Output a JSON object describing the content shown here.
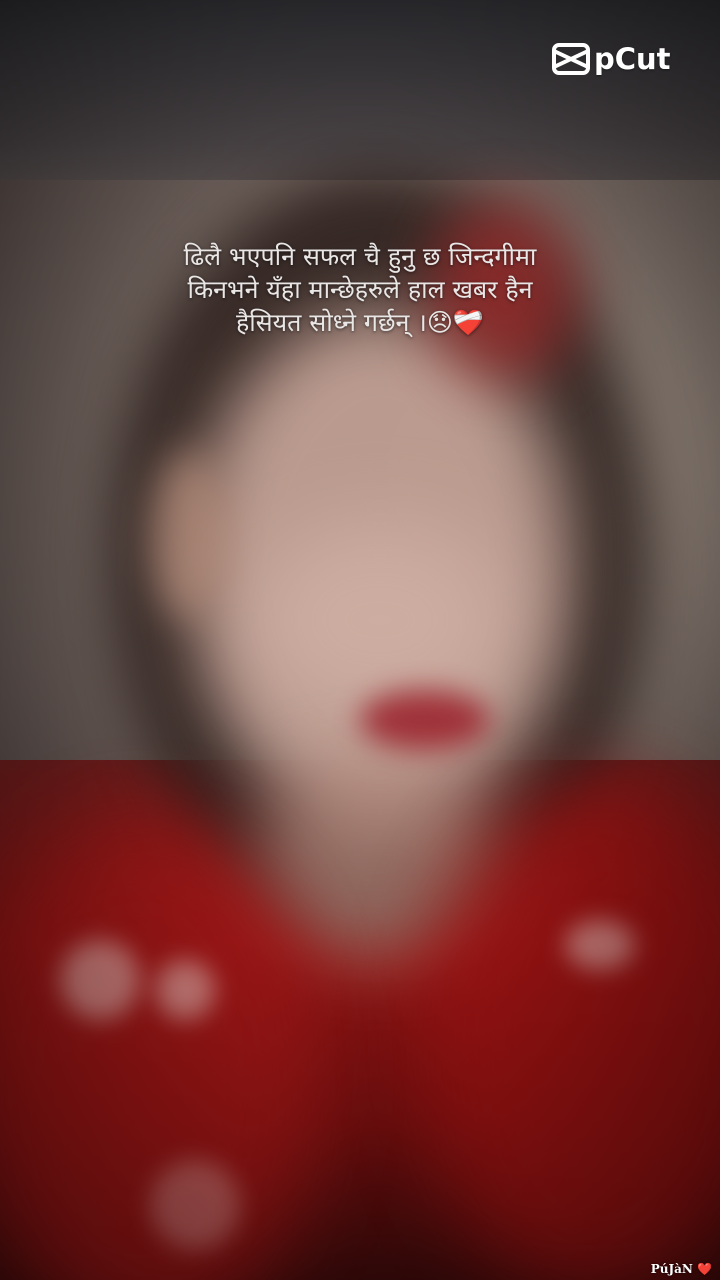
{
  "brand": {
    "logo_text": "CapCut",
    "logo_visible_text": "pCut"
  },
  "caption": {
    "lines": [
      "ढिलै भएपनि सफल चै हुनु छ जिन्दगीमा",
      "किनभने यँहा मान्छेहरुले हाल खबर हैन",
      "हैसियत सोध्ने गर्छन् ।😞❤️‍🩹"
    ]
  },
  "watermark": {
    "text": "PúJàN ❤️"
  },
  "colors": {
    "dress": "#9c1212",
    "text": "#e9e6e6"
  }
}
